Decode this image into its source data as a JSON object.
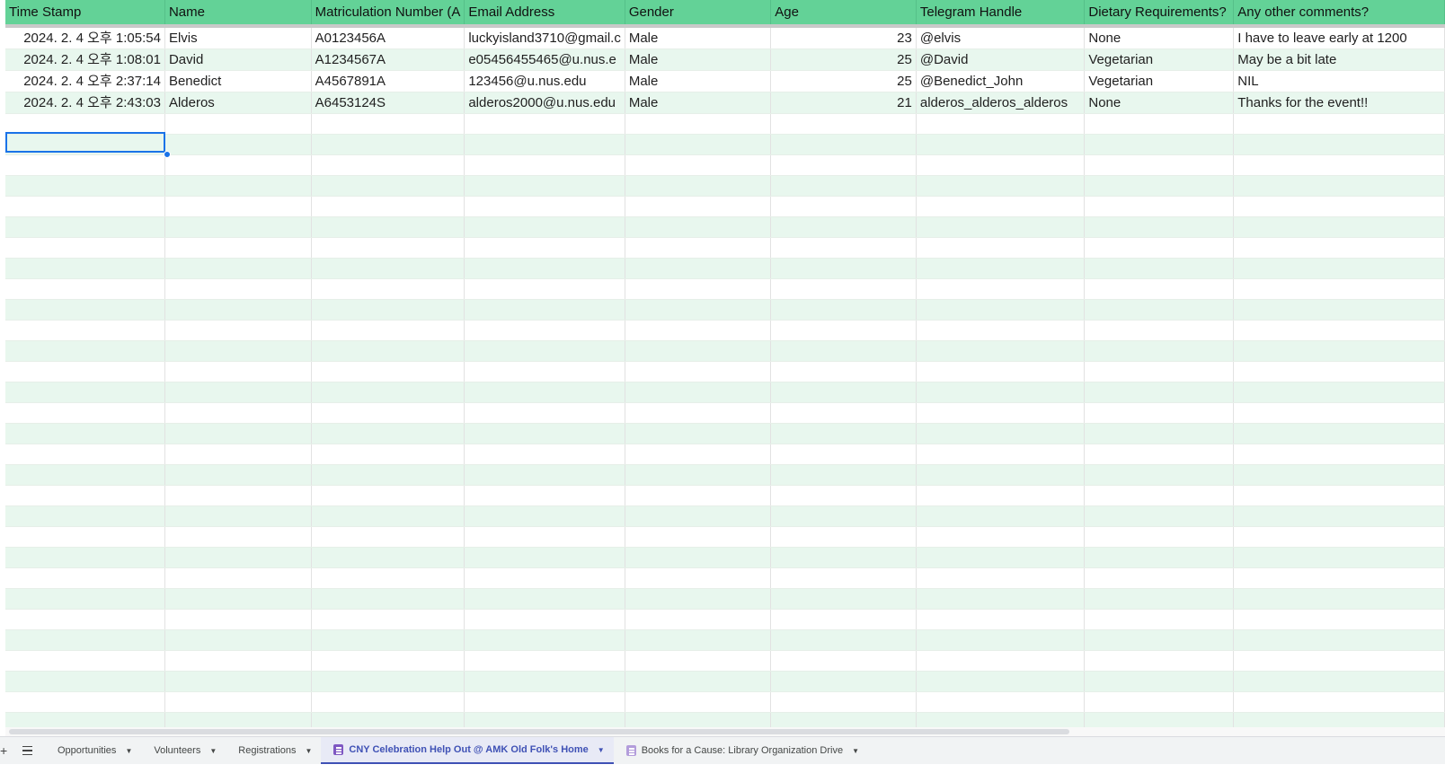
{
  "sheet": {
    "headers": [
      "Time Stamp",
      "Name",
      "Matriculation Number (A",
      "Email Address",
      "Gender",
      "Age",
      "Telegram Handle",
      "Dietary Requirements?",
      "Any other comments?"
    ],
    "rows": [
      [
        "2024. 2. 4 오후 1:05:54",
        "Elvis",
        "A0123456A",
        "luckyisland3710@gmail.c",
        "Male",
        "23",
        "@elvis",
        "None",
        "I have to leave early at 1200"
      ],
      [
        "2024. 2. 4 오후 1:08:01",
        "David",
        "A1234567A",
        "e05456455465@u.nus.e",
        "Male",
        "25",
        "@David",
        "Vegetarian",
        "May be a bit late"
      ],
      [
        "2024. 2. 4 오후 2:37:14",
        "Benedict",
        "A4567891A",
        "123456@u.nus.edu",
        "Male",
        "25",
        "@Benedict_John",
        "Vegetarian",
        "NIL"
      ],
      [
        "2024. 2. 4 오후 2:43:03",
        "Alderos",
        "A6453124S",
        "alderos2000@u.nus.edu",
        "Male",
        "21",
        "alderos_alderos_alderos",
        "None",
        "Thanks for the event!!"
      ]
    ],
    "header_color": "#63d297",
    "band_color": "#e8f7ee",
    "selection_color": "#1a73e8"
  },
  "tabbar": {
    "add_icon": "+",
    "menu_icon": "all-sheets-icon",
    "tabs": [
      {
        "label": "Opportunities",
        "active": false,
        "form_icon": false
      },
      {
        "label": "Volunteers",
        "active": false,
        "form_icon": false
      },
      {
        "label": "Registrations",
        "active": false,
        "form_icon": false
      },
      {
        "label": "CNY Celebration Help Out @ AMK Old Folk's Home",
        "active": true,
        "form_icon": true
      },
      {
        "label": "Books for a Cause: Library Organization Drive",
        "active": false,
        "form_icon": true
      }
    ]
  }
}
